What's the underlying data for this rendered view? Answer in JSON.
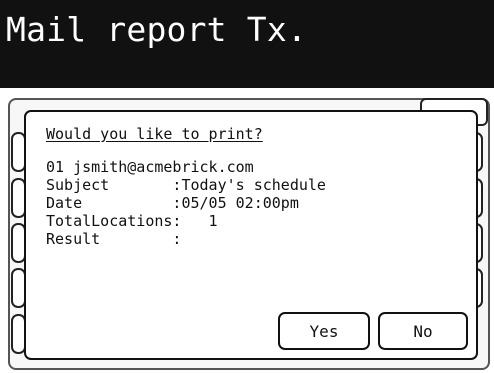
{
  "header": {
    "title": "Mail report Tx."
  },
  "dialog": {
    "question": "Would you like to print?",
    "recipient": "01 jsmith@acmebrick.com",
    "subject": "Subject       :Today's schedule",
    "date": "Date          :05/05 02:00pm",
    "total_locations": "TotalLocations:   1",
    "result": "Result        :"
  },
  "buttons": {
    "yes": "Yes",
    "no": "No"
  }
}
